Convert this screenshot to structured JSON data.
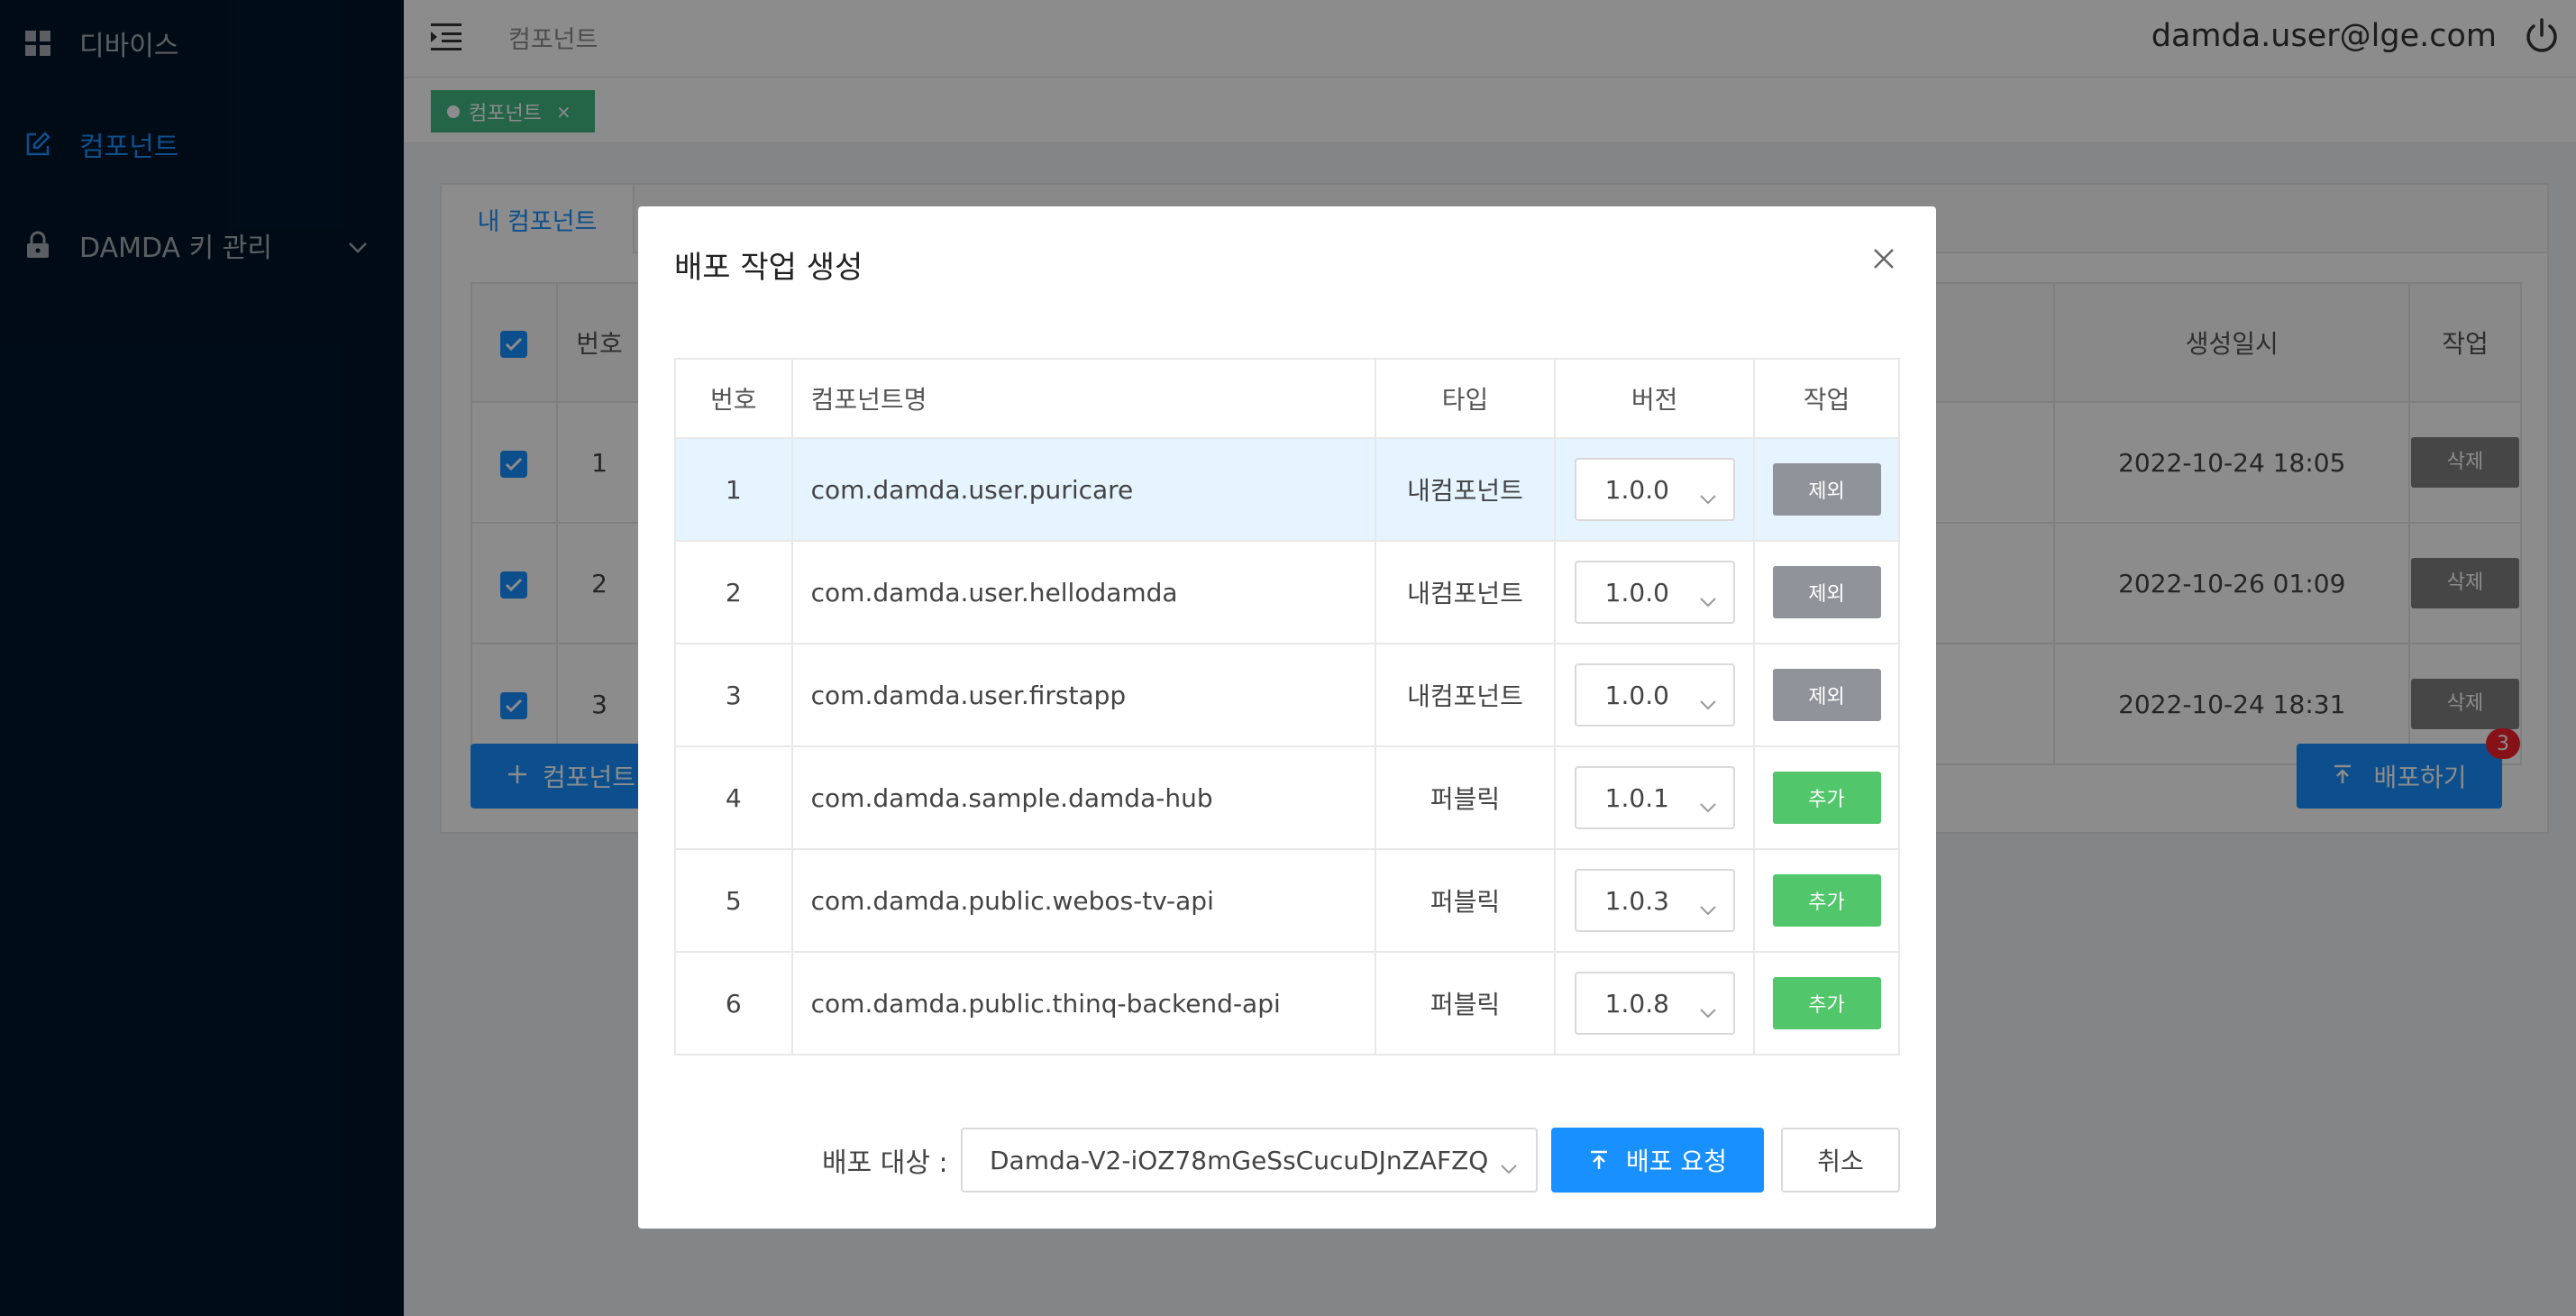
{
  "sidebar": {
    "items": [
      {
        "label": "디바이스",
        "icon": "dashboard-icon"
      },
      {
        "label": "컴포넌트",
        "icon": "edit-icon"
      },
      {
        "label": "DAMDA 키 관리",
        "icon": "lock-icon"
      }
    ]
  },
  "header": {
    "breadcrumb": "컴포넌트",
    "user_email": "damda.user@lge.com"
  },
  "tags": [
    {
      "label": "컴포넌트",
      "close": "×"
    }
  ],
  "card": {
    "tab": "내 컴포넌트",
    "headers": {
      "num": "번호",
      "created": "생성일시",
      "action": "작업"
    },
    "rows": [
      {
        "num": "1",
        "created": "2022-10-24 18:05",
        "action": "삭제"
      },
      {
        "num": "2",
        "created": "2022-10-26 01:09",
        "action": "삭제"
      },
      {
        "num": "3",
        "created": "2022-10-24 18:31",
        "action": "삭제"
      }
    ],
    "add_button": "컴포넌트",
    "deploy_button": "배포하기",
    "deploy_badge": "3"
  },
  "modal": {
    "title": "배포 작업 생성",
    "headers": {
      "num": "번호",
      "name": "컴포넌트명",
      "type": "타입",
      "version": "버전",
      "action": "작업"
    },
    "rows": [
      {
        "num": "1",
        "name": "com.damda.user.puricare",
        "type": "내컴포넌트",
        "version": "1.0.0",
        "action": "제외"
      },
      {
        "num": "2",
        "name": "com.damda.user.hellodamda",
        "type": "내컴포넌트",
        "version": "1.0.0",
        "action": "제외"
      },
      {
        "num": "3",
        "name": "com.damda.user.firstapp",
        "type": "내컴포넌트",
        "version": "1.0.0",
        "action": "제외"
      },
      {
        "num": "4",
        "name": "com.damda.sample.damda-hub",
        "type": "퍼블릭",
        "version": "1.0.1",
        "action": "추가"
      },
      {
        "num": "5",
        "name": "com.damda.public.webos-tv-api",
        "type": "퍼블릭",
        "version": "1.0.3",
        "action": "추가"
      },
      {
        "num": "6",
        "name": "com.damda.public.thinq-backend-api",
        "type": "퍼블릭",
        "version": "1.0.8",
        "action": "추가"
      }
    ],
    "target_label": "배포 대상 :",
    "target_value": "Damda-V2-iOZ78mGeSsCucuDJnZAFZQ",
    "request_button": "배포 요청",
    "cancel_button": "취소"
  },
  "colors": {
    "sidebar_bg": "#001529",
    "primary": "#1890ff",
    "tag_green": "#42b983",
    "exclude_gray": "#909399",
    "add_green": "#52c66b",
    "highlight_row": "#e6f4ff",
    "badge_red": "#f5222d"
  }
}
